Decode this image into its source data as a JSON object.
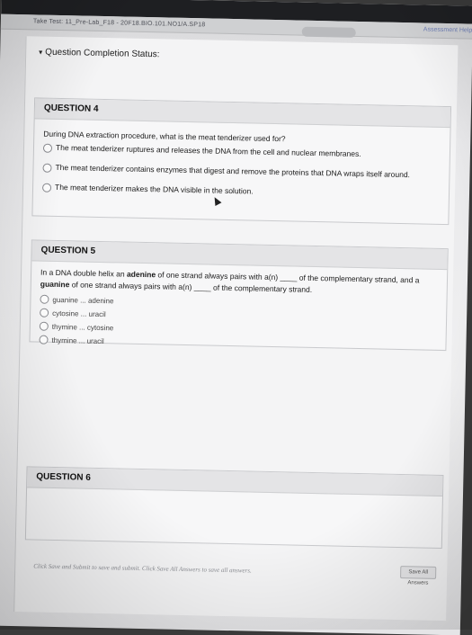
{
  "breadcrumb": "Take Test: 11_Pre-Lab_F18 - 20F18.BIO.101.NO1/A.SP18",
  "help_link": "Assessment Help",
  "status_label": "Question Completion Status:",
  "save_all_label": "Save All Answers",
  "footer_note": "Click Save and Submit to save and submit. Click Save All Answers to save all answers.",
  "questions": [
    {
      "title": "QUESTION 4",
      "text": "During DNA extraction procedure, what is the meat tenderizer used for?",
      "options": [
        "The meat tenderizer ruptures and releases the DNA from the cell and nuclear membranes.",
        "The meat tenderizer contains enzymes that digest and remove the proteins that DNA wraps itself around.",
        "The meat tenderizer makes the DNA visible in the solution."
      ]
    },
    {
      "title": "QUESTION 5",
      "text_parts": [
        "In a DNA double helix an ",
        "adenine",
        " of one strand always pairs with a(n) ____ of the complementary strand, and a ",
        "guanine",
        " of one strand always pairs with a(n) ____ of the complementary strand."
      ],
      "options": [
        "guanine ... adenine",
        "cytosine ... uracil",
        "thymine ... cytosine",
        "thymine ... uracil"
      ]
    },
    {
      "title": "QUESTION 6"
    }
  ]
}
